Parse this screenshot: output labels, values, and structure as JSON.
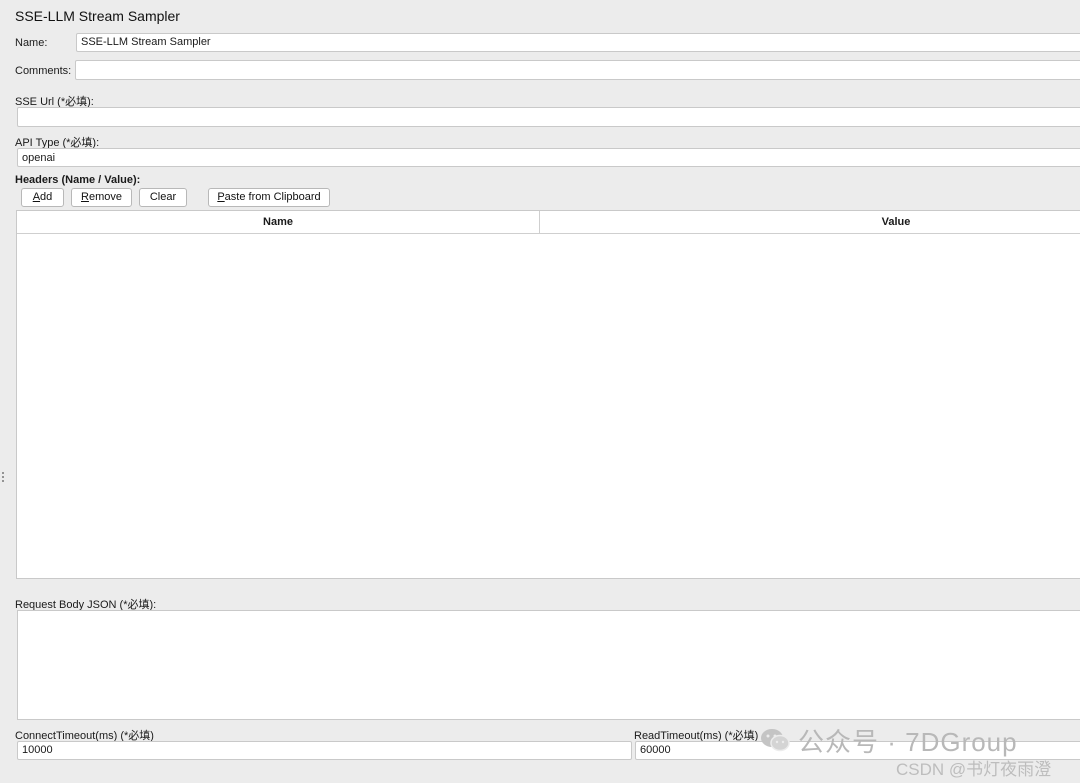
{
  "title": "SSE-LLM Stream Sampler",
  "name_field": {
    "label": "Name:",
    "value": "SSE-LLM Stream Sampler"
  },
  "comments_field": {
    "label": "Comments:",
    "value": ""
  },
  "sse_url": {
    "label": "SSE Url (*必填):",
    "value": ""
  },
  "api_type": {
    "label": "API Type (*必填):",
    "value": "openai"
  },
  "headers": {
    "label": "Headers (Name / Value):",
    "buttons": {
      "add": {
        "mnemonic": "A",
        "rest": "dd"
      },
      "remove": {
        "mnemonic": "R",
        "rest": "emove"
      },
      "clear": {
        "label": "Clear"
      },
      "paste": {
        "mnemonic": "P",
        "rest": "aste from Clipboard"
      }
    },
    "columns": [
      "Name",
      "Value"
    ],
    "rows": []
  },
  "request_body": {
    "label": "Request Body JSON (*必填):",
    "value": ""
  },
  "connect_timeout": {
    "label": "ConnectTimeout(ms) (*必填)",
    "value": "10000"
  },
  "read_timeout": {
    "label": "ReadTimeout(ms) (*必填)",
    "value": "60000"
  },
  "watermark": {
    "main": "公众号 · 7DGroup",
    "sub": "CSDN @书灯夜雨澄"
  }
}
